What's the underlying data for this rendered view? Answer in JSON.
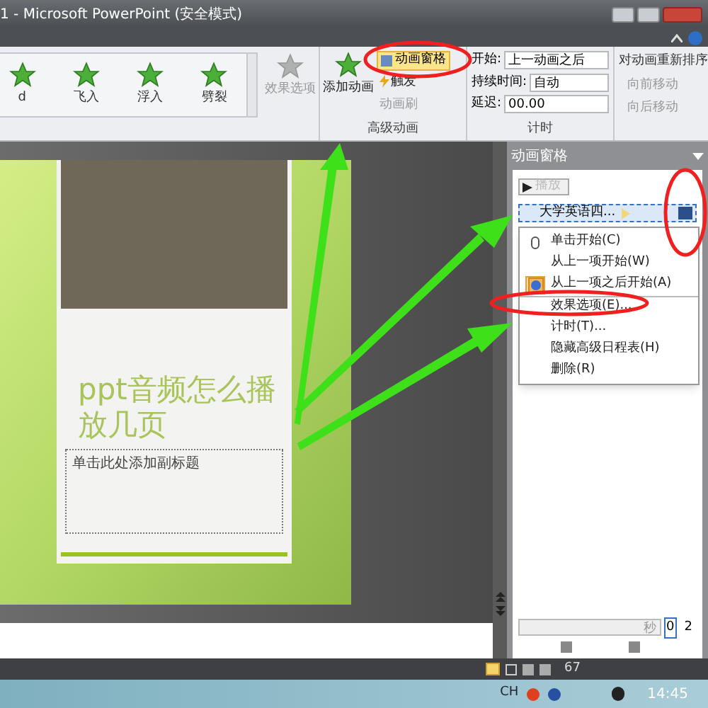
{
  "window": {
    "title": "1 - Microsoft PowerPoint (安全模式)"
  },
  "ribbon": {
    "gallery": [
      {
        "label": "d",
        "selected": false
      },
      {
        "label": "飞入",
        "selected": false
      },
      {
        "label": "浮入",
        "selected": false
      },
      {
        "label": "劈裂",
        "selected": false
      }
    ],
    "effect_options": {
      "label": "效果选项",
      "disabled": true
    },
    "advanced": {
      "add_animation": "添加动画",
      "pane_button": {
        "label": "动画窗格",
        "selected": true
      },
      "trigger": {
        "label": "触发",
        "disabled": false
      },
      "painter": {
        "label": "动画刷",
        "disabled": true
      },
      "group_label": "高级动画"
    },
    "timing": {
      "start_label": "开始:",
      "start_value": "上一动画之后",
      "duration_label": "持续时间:",
      "duration_value": "自动",
      "delay_label": "延迟:",
      "delay_value": "00.00",
      "group_label": "计时"
    },
    "reorder": {
      "title": "对动画重新排序",
      "items": [
        {
          "label": "向前移动",
          "disabled": true
        },
        {
          "label": "向后移动",
          "disabled": true
        }
      ]
    }
  },
  "slide": {
    "title": "ppt音频怎么播放几页",
    "subtitle_placeholder": "单击此处添加副标题"
  },
  "animation_pane": {
    "title": "动画窗格",
    "play_button": {
      "label": "播放",
      "disabled": true
    },
    "item": {
      "label": "大学英语四..."
    },
    "menu": [
      {
        "label": "单击开始(C)",
        "kind": "mouse",
        "checked": false,
        "divider_before": false
      },
      {
        "label": "从上一项开始(W)",
        "kind": "plain",
        "checked": false,
        "divider_before": false
      },
      {
        "label": "从上一项之后开始(A)",
        "kind": "clock",
        "checked": true,
        "divider_before": false
      },
      {
        "label": "效果选项(E)...",
        "kind": "plain",
        "checked": false,
        "divider_before": true
      },
      {
        "label": "计时(T)...",
        "kind": "plain",
        "checked": false,
        "divider_before": false
      },
      {
        "label": "隐藏高级日程表(H)",
        "kind": "plain",
        "checked": false,
        "divider_before": false
      },
      {
        "label": "删除(R)",
        "kind": "plain",
        "checked": false,
        "divider_before": false
      }
    ],
    "seconds": "秒",
    "timeline_start": "0",
    "timeline_end": "2"
  },
  "status_bar": {
    "zoom": "67"
  },
  "taskbar": {
    "language": "CH",
    "time": "14:45"
  }
}
